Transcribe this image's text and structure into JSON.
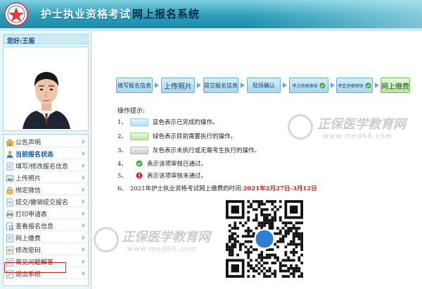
{
  "header": {
    "title": "护士执业资格考试",
    "subtitle": "网上报名系统"
  },
  "user": {
    "greeting": "您好:王振"
  },
  "menu": {
    "items": [
      {
        "label": "公告声明",
        "icon": "house-icon"
      },
      {
        "label": "当前报名状态",
        "icon": "person-icon",
        "active": true
      },
      {
        "label": "填写/修改报名信息",
        "icon": "form-icon"
      },
      {
        "label": "上传照片",
        "icon": "photo-icon"
      },
      {
        "label": "绑定微信",
        "icon": "lock-icon"
      },
      {
        "label": "提交/撤销提交报名",
        "icon": "document-icon"
      },
      {
        "label": "打印申请表",
        "icon": "printer-icon"
      },
      {
        "label": "查看报名信息",
        "icon": "view-icon"
      },
      {
        "label": "网上缴费",
        "icon": "payment-icon"
      },
      {
        "label": "修改密码",
        "icon": "key-icon"
      },
      {
        "label": "常见问题解答",
        "icon": "question-icon"
      },
      {
        "label": "退出系统",
        "icon": "exit-icon"
      }
    ]
  },
  "steps": [
    {
      "label": "填写报名信息",
      "state": "done"
    },
    {
      "label": "上传照片",
      "state": "done"
    },
    {
      "label": "提交报名信息",
      "state": "done"
    },
    {
      "label": "现场确认",
      "state": "done"
    },
    {
      "label": "考点资格审核",
      "state": "done",
      "checked": true
    },
    {
      "label": "考区资格审核",
      "state": "done",
      "checked": true
    },
    {
      "label": "网上缴费",
      "state": "current"
    }
  ],
  "tips": {
    "title": "操作提示:",
    "items": [
      {
        "num": "1、",
        "text": "蓝色表示已完成的操作。"
      },
      {
        "num": "2、",
        "text": "绿色表示目前需要执行的操作。"
      },
      {
        "num": "3、",
        "text": "灰色表示未执行或无需考生执行的操作。"
      },
      {
        "num": "4、",
        "text": "表示该项审核已通过。"
      },
      {
        "num": "5、",
        "text": "表示该项审核未通过。"
      },
      {
        "num": "6、",
        "text": "2021年护士执业资格考试网上缴费的时间:",
        "highlight": "2021年2月27日-3月12日"
      }
    ]
  },
  "watermark": {
    "brand": "正保医学教育网",
    "url": "www.med66.com"
  },
  "colors": {
    "header": "#2e9db9",
    "done_step": "#a8d6ef",
    "current_step": "#b7e4a2",
    "deadline": "#d21717",
    "highlight_box": "#d62020"
  }
}
